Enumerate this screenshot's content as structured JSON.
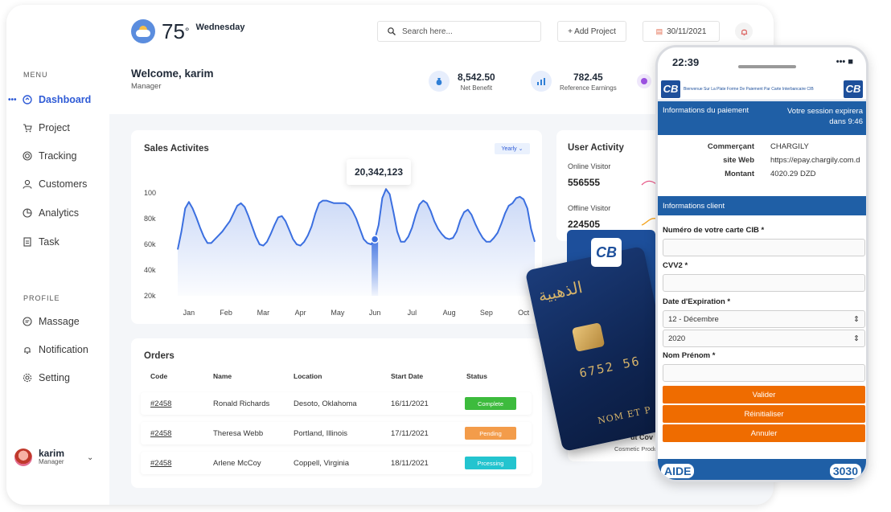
{
  "sidebar": {
    "menu_label": "MENU",
    "items": [
      {
        "label": "Dashboard",
        "icon": "dashboard-icon",
        "active": true
      },
      {
        "label": "Project",
        "icon": "cart-icon"
      },
      {
        "label": "Tracking",
        "icon": "tracking-icon"
      },
      {
        "label": "Customers",
        "icon": "user-icon"
      },
      {
        "label": "Analytics",
        "icon": "pie-chart-icon"
      },
      {
        "label": "Task",
        "icon": "task-icon"
      }
    ],
    "profile_label": "PROFILE",
    "profile_items": [
      {
        "label": "Massage",
        "icon": "message-icon"
      },
      {
        "label": "Notification",
        "icon": "bell-icon"
      },
      {
        "label": "Setting",
        "icon": "gear-icon"
      }
    ],
    "user": {
      "name": "karim",
      "role": "Manager"
    }
  },
  "header": {
    "temperature": "75",
    "day": "Wednesday",
    "search_placeholder": "Search here...",
    "add_project": "+ Add Project",
    "date": "30/11/2021"
  },
  "welcome": {
    "title": "Welcome, karim",
    "role": "Manager"
  },
  "stats": [
    {
      "value": "8,542.50",
      "label": "Net Benefit"
    },
    {
      "value": "782.45",
      "label": "Reference Earnings"
    }
  ],
  "sales": {
    "title": "Sales Activites",
    "filter": "Yearly",
    "tooltip": "20,342,123"
  },
  "chart_data": {
    "type": "area",
    "title": "Sales Activites",
    "categories": [
      "Jan",
      "Feb",
      "Mar",
      "Apr",
      "May",
      "Jun",
      "Jul",
      "Aug",
      "Sep",
      "Oct"
    ],
    "y_ticks": [
      "100",
      "80k",
      "60k",
      "40k",
      "20k"
    ],
    "ylim": [
      20,
      100
    ],
    "x": [
      0.0,
      0.1,
      0.2,
      0.3,
      0.4,
      0.5,
      0.6,
      0.7,
      0.8,
      0.9,
      1.0,
      1.1,
      1.2,
      1.3,
      1.4,
      1.5,
      1.6,
      1.7,
      1.8,
      1.9,
      2.0,
      2.1,
      2.2,
      2.3,
      2.4,
      2.5,
      2.6,
      2.7,
      2.8,
      2.9,
      3.0,
      3.1,
      3.2,
      3.3,
      3.4,
      3.5,
      3.6,
      3.7,
      3.8,
      3.9,
      4.0,
      4.1,
      4.2,
      4.3,
      4.4,
      4.5,
      4.6,
      4.7,
      4.8,
      4.9,
      5.0,
      5.1,
      5.2,
      5.3,
      5.4,
      5.5,
      5.6,
      5.7,
      5.8,
      5.9,
      6.0,
      6.1,
      6.2,
      6.3,
      6.4,
      6.5,
      6.6,
      6.7,
      6.8,
      6.9,
      7.0,
      7.1,
      7.2,
      7.3,
      7.4,
      7.5,
      7.6,
      7.7,
      7.8,
      7.9,
      8.0,
      8.1,
      8.2,
      8.3,
      8.4,
      8.5,
      8.6,
      8.7,
      8.8,
      8.9,
      9.0,
      9.1,
      9.2,
      9.3,
      9.4,
      9.5,
      9.6
    ],
    "values": [
      56,
      70,
      88,
      93,
      88,
      81,
      73,
      66,
      61,
      61,
      64,
      67,
      70,
      74,
      78,
      84,
      90,
      92,
      89,
      82,
      74,
      66,
      60,
      59,
      62,
      68,
      75,
      81,
      82,
      78,
      71,
      64,
      60,
      59,
      62,
      67,
      74,
      84,
      92,
      94,
      94,
      93,
      92,
      92,
      92,
      92,
      90,
      86,
      80,
      72,
      64,
      61,
      60,
      64,
      75,
      96,
      103,
      99,
      85,
      70,
      62,
      62,
      66,
      73,
      83,
      91,
      94,
      92,
      86,
      78,
      72,
      68,
      65,
      64,
      65,
      70,
      79,
      85,
      87,
      83,
      76,
      70,
      65,
      62,
      62,
      65,
      69,
      76,
      84,
      90,
      92,
      96,
      97,
      95,
      88,
      72,
      62
    ],
    "highlight": {
      "category": "Jun",
      "label": "20,342,123"
    }
  },
  "user_activity": {
    "title": "User Activity",
    "online_label": "Online Visitor",
    "online_value": "556555",
    "offline_label": "Offline Visitor",
    "offline_value": "224505",
    "partial_label": "Cosmetic Produ",
    "partial_title": "ut Cov"
  },
  "orders": {
    "title": "Orders",
    "headers": [
      "Code",
      "Name",
      "Location",
      "Start Date",
      "Status"
    ],
    "rows": [
      {
        "code": "#2458",
        "name": "Ronald Richards",
        "location": "Desoto, Oklahoma",
        "date": "16/11/2021",
        "status": "Complete",
        "color": "#3dbb3d"
      },
      {
        "code": "#2458",
        "name": "Theresa Webb",
        "location": "Portland, Illinois",
        "date": "17/11/2021",
        "status": "Pending",
        "color": "#f39c4a"
      },
      {
        "code": "#2458",
        "name": "Arlene McCoy",
        "location": "Coppell, Virginia",
        "date": "18/11/2021",
        "status": "Prcessing",
        "color": "#23c4cf"
      }
    ]
  },
  "card": {
    "arabic": "الذهبية",
    "number": "6752 56",
    "name": "NOM ET P",
    "logo": "CB"
  },
  "phone": {
    "time": "22:39",
    "status_icons": "••• ■",
    "cib_tagline": "Bienvenue Sur La Plate Forme De Paiement Par Carte Interbancaire CIB",
    "payment_info": "Informations du paiement",
    "session": "Votre session expirera dans 9:46",
    "merchant_key": "Commerçant",
    "merchant_val": "CHARGILY",
    "site_key": "site Web",
    "site_val": "https://epay.chargily.com.d",
    "amount_key": "Montant",
    "amount_val": "4020.29 DZD",
    "client_info": "Informations client",
    "card_number_label": "Numéro de votre carte CIB *",
    "cvv_label": "CVV2 *",
    "expiry_label": "Date d'Expiration *",
    "month": "12 - Décembre",
    "year": "2020",
    "name_label": "Nom Prénom *",
    "validate": "Valider",
    "reset": "Réinitialiser",
    "cancel": "Annuler",
    "aide": "AIDE",
    "phone_number": "3030"
  },
  "colors": {
    "accent": "#2f5bd6",
    "chart_line": "#3b6fe0",
    "cib_blue": "#1f5fa6",
    "orange": "#ef6c00"
  }
}
